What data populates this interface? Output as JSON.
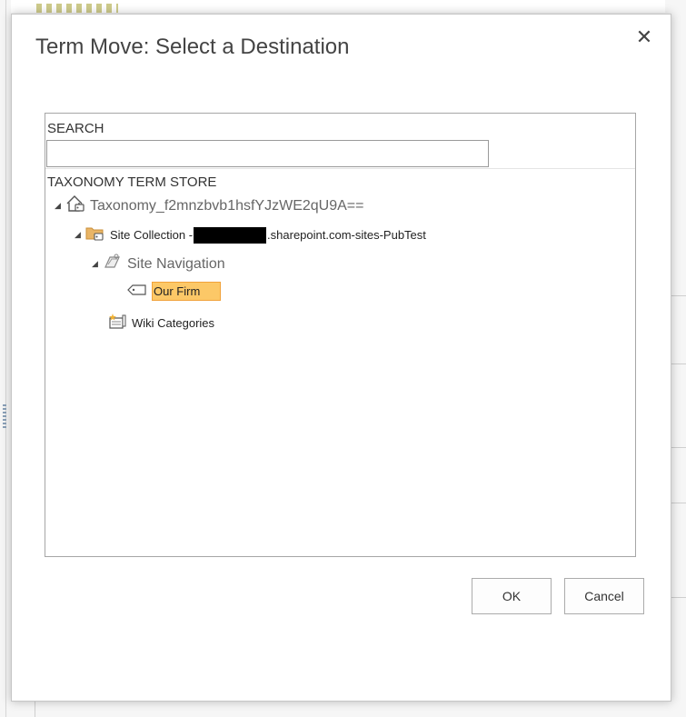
{
  "dialog": {
    "title": "Term Move: Select a Destination",
    "close_glyph": "✕",
    "close_icon": "close-icon"
  },
  "search": {
    "label": "SEARCH",
    "value": "",
    "placeholder": ""
  },
  "tree": {
    "header": "TAXONOMY TERM STORE",
    "root": {
      "label": "Taxonomy_f2mnzbvb1hsfYJzWE2qU9A==",
      "icon": "term-store-house-icon",
      "expanded": true
    },
    "site_collection": {
      "label_prefix": "Site Collection - ",
      "label_suffix": ".sharepoint.com-sites-PubTest",
      "icon": "folder-icon",
      "expanded": true,
      "redacted": true
    },
    "site_navigation": {
      "label": "Site Navigation",
      "icon": "term-set-icon",
      "expanded": true
    },
    "our_firm": {
      "label": "Our Firm",
      "icon": "tag-icon",
      "selected": true
    },
    "wiki_categories": {
      "label": "Wiki Categories",
      "icon": "term-set-star-icon"
    }
  },
  "buttons": {
    "ok": "OK",
    "cancel": "Cancel"
  },
  "colors": {
    "selected_bg": "#fcc867",
    "selected_border": "#f1a23a",
    "title": "#444444"
  }
}
